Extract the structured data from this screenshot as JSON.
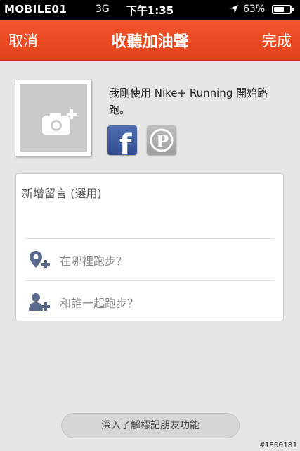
{
  "status_bar": {
    "carrier_logo": "MOBILE01",
    "network": "3G",
    "time": "下午1:35",
    "battery_percent": "63%",
    "battery_level": 0.63
  },
  "nav": {
    "left_label": "取消",
    "title": "收聽加油聲",
    "right_label": "完成"
  },
  "share": {
    "text": "我剛使用 Nike+ Running 開始路跑。",
    "facebook_glyph": "f",
    "pinterest_glyph": "P"
  },
  "comment": {
    "placeholder": "新增留言 (選用)"
  },
  "rows": {
    "location_label": "在哪裡跑步？",
    "friends_label": "和誰一起跑步？"
  },
  "learn_more": {
    "label": "深入了解標記朋友功能"
  },
  "watermark": "#1800181",
  "colors": {
    "nav_bg": "#e84a20",
    "facebook": "#3b5998",
    "icon_accent": "#5a6a8c"
  },
  "icons": [
    "location-icon",
    "camera-plus-icon",
    "facebook-icon",
    "pinterest-icon",
    "map-pin-add-icon",
    "person-add-icon"
  ]
}
